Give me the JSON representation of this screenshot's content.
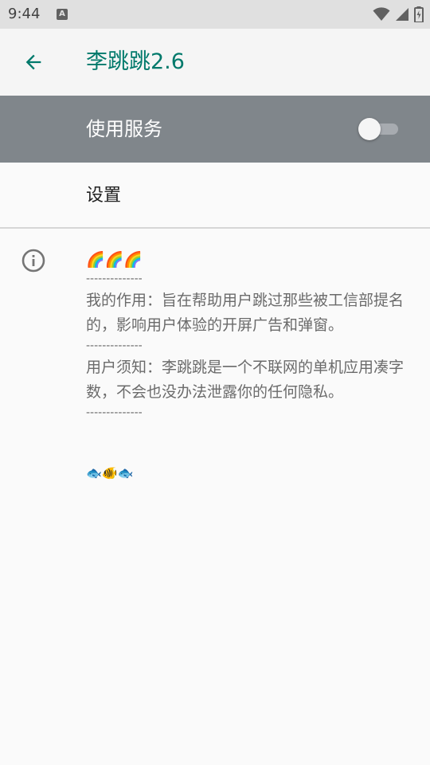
{
  "status_bar": {
    "time": "9:44",
    "notification_letter": "A",
    "icons": [
      "wifi-icon",
      "signal-icon",
      "battery-charging-icon"
    ]
  },
  "app_bar": {
    "title": "李跳跳2.6",
    "back_icon": "arrow-back-icon",
    "accent_color": "#00796b"
  },
  "master_switch": {
    "label": "使用服务",
    "checked": false,
    "background_color": "#80868b"
  },
  "settings": {
    "label": "设置"
  },
  "info": {
    "icon": "info-icon",
    "top_emoji": "🌈🌈🌈",
    "separator": "--------------",
    "paragraphs": [
      "我的作用：旨在帮助用户跳过那些被工信部提名的，影响用户体验的开屏广告和弹窗。",
      "用户须知：李跳跳是一个不联网的单机应用凑字数，不会也没办法泄露你的任何隐私。"
    ],
    "bottom_emoji": "🐟🐠🐟"
  }
}
